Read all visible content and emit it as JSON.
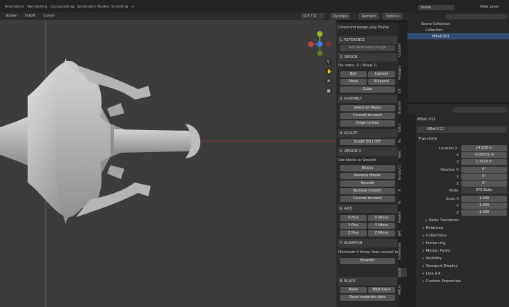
{
  "workspace_tabs": [
    "Animation",
    "Rendering",
    "Compositing",
    "Geometry Nodes",
    "Scripting",
    "+"
  ],
  "toolbar": {
    "stroke": "Stroke",
    "falloff": "Falloff",
    "cursor": "Cursor",
    "dyntopo": "Dyntopo",
    "remesh": "Remesh",
    "options": "Options"
  },
  "header_right": {
    "scene": "Scene",
    "view_layer": "View Layer"
  },
  "npanel": {
    "title": "Crossmind design play Plume",
    "reference": {
      "header": "1. REFERENCE",
      "button": "Add Reference Image"
    },
    "design": {
      "header": "2. DESIGN",
      "hint": "Pie menu: D | Move: G",
      "buttons": [
        "Ball",
        "Capsule",
        "Plane",
        "Ellipsoid",
        "Cube"
      ]
    },
    "assembly": {
      "header": "3. ASSEMBLY",
      "buttons": [
        "Select all Metas",
        "Convert to mesh",
        "Origin to Geo"
      ]
    },
    "sculpt": {
      "header": "4. SCULPT",
      "button": "Sculpt ON | OFF"
    },
    "design2": {
      "header": "5. DESIGN II",
      "hint": "Use blocks or Smooth.",
      "buttons": [
        "Blocks",
        "Remove Blocks",
        "Smooth",
        "Remove Smooth",
        "Convert to mesh"
      ]
    },
    "axis": {
      "header": "6. AXIS",
      "buttons": [
        "X Plus",
        "X Minus",
        "Y Plus",
        "Y Minus",
        "Z Plus",
        "Z Minus"
      ]
    },
    "blowfish": {
      "header": "7. BLOWFISH",
      "hint": "Maximum 4 times, then convert to ...",
      "button": "Blowfish"
    },
    "black": {
      "header": "8. BLACK",
      "buttons": [
        "Black",
        "Matt black",
        "Reset materials slots"
      ]
    }
  },
  "vertical_tabs": [
    "Quad Re",
    "Photogra",
    "KIT",
    "Grassrm",
    "QSCa",
    "Ru",
    "Hard",
    "Simply Cu",
    "Tr",
    "Vi",
    "PowerS",
    "BAT",
    "Screencast",
    "Cloud",
    "MACH"
  ],
  "outliner": {
    "items": [
      "Scene Collection",
      "Collection",
      "MBall.011"
    ]
  },
  "properties": {
    "object_name": "MBall.011",
    "data_name": "MBall.011",
    "transform_header": "Transform",
    "location": {
      "label": "Location X",
      "x": "14.106 m",
      "y": "-0.00001 m",
      "z": "1.3529 m"
    },
    "rotation": {
      "label": "Rotation X",
      "x": "0°",
      "y": "0°",
      "z": "0°"
    },
    "mode": {
      "label": "Mode",
      "value": "XYZ Euler"
    },
    "scale": {
      "label": "Scale X",
      "x": "1.000",
      "y": "1.000",
      "z": "1.000"
    },
    "axis_labels": {
      "y": "Y",
      "z": "Z"
    },
    "delta": "Delta Transform",
    "categories": [
      "Relations",
      "Collections",
      "Instancing",
      "Motion Paths",
      "Visibility",
      "Viewport Display",
      "Line Art",
      "Custom Properties"
    ]
  },
  "colors": {
    "viewport": "#3c3c3c",
    "axis_x": "#c04848",
    "axis_y": "#8cb832",
    "axis_z": "#3b7de0",
    "accent": "#3a73c0"
  }
}
